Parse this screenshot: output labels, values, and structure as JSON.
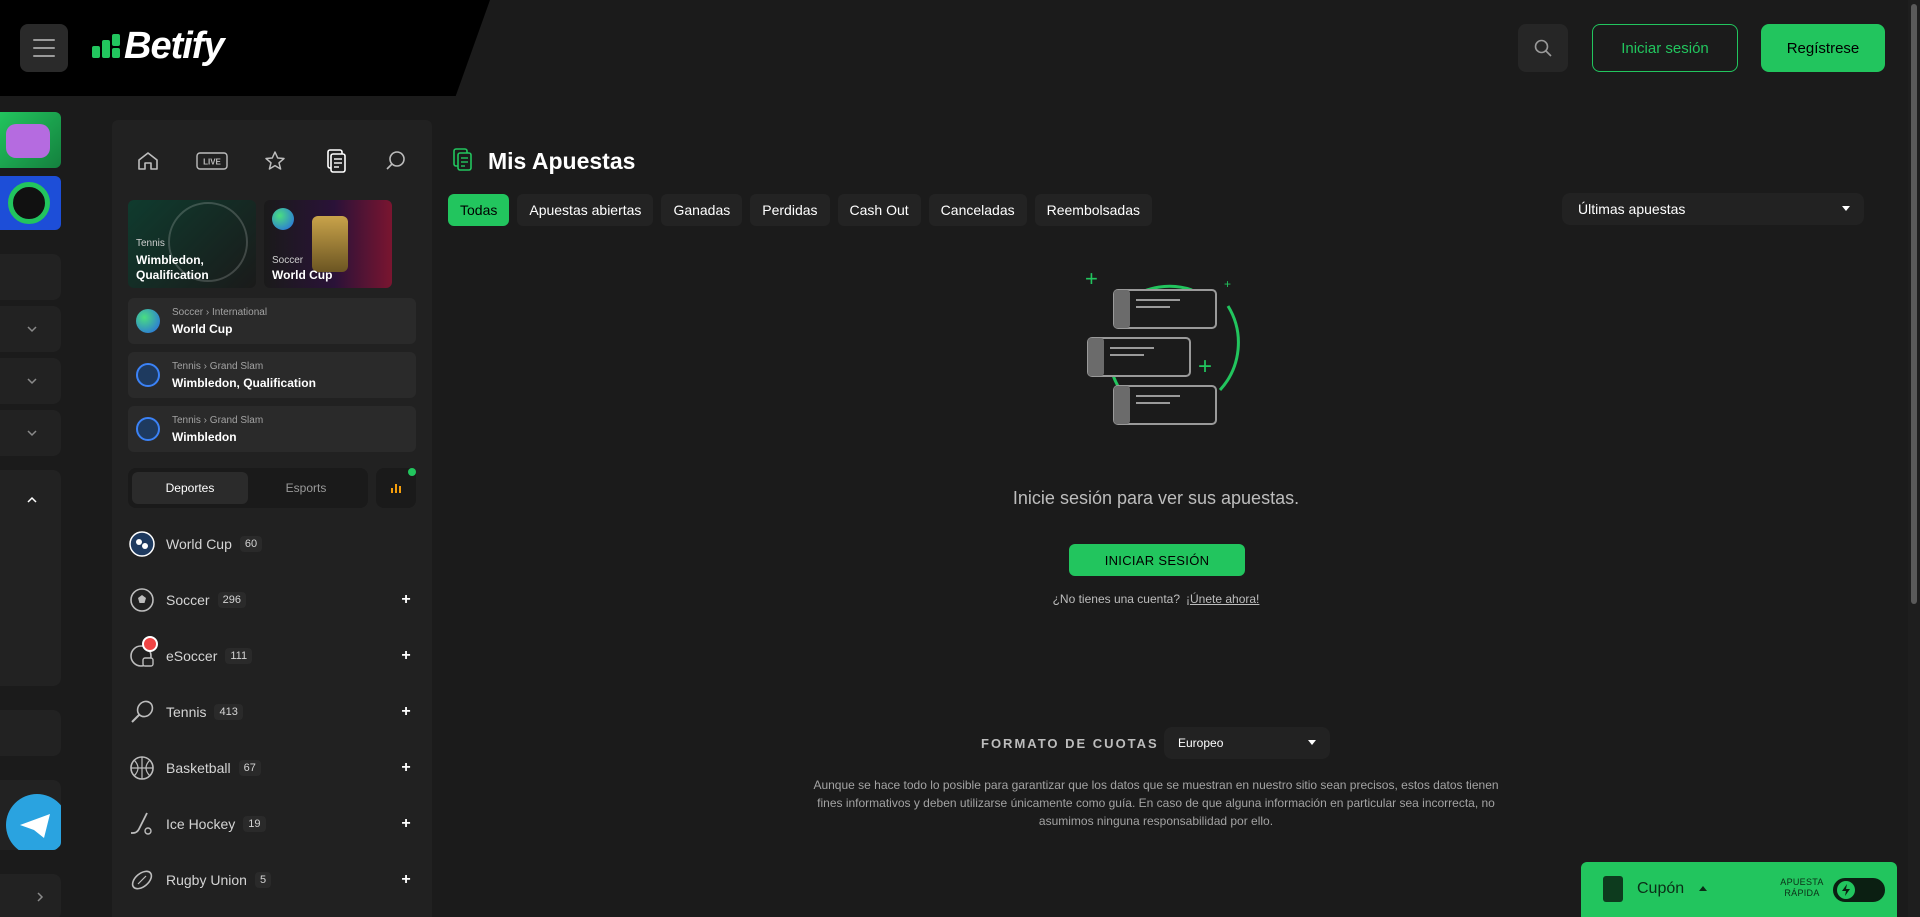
{
  "header": {
    "logo_text": "Betify",
    "login_label": "Iniciar sesión",
    "register_label": "Regístrese"
  },
  "sidebar": {
    "nav_icons": [
      "home-icon",
      "live-icon",
      "star-icon",
      "bets-slip-icon",
      "search-icon"
    ],
    "live_badge": "LIVE",
    "featured": [
      {
        "sport": "Tennis",
        "event": "Wimbledon, Qualification"
      },
      {
        "sport": "Soccer",
        "event": "World Cup"
      }
    ],
    "events": [
      {
        "crumb": "Soccer › International",
        "name": "World Cup"
      },
      {
        "crumb": "Tennis › Grand Slam",
        "name": "Wimbledon, Qualification"
      },
      {
        "crumb": "Tennis › Grand Slam",
        "name": "Wimbledon"
      }
    ],
    "segment": {
      "sports": "Deportes",
      "esports": "Esports"
    },
    "sports": [
      {
        "name": "World Cup",
        "count": "60"
      },
      {
        "name": "Soccer",
        "count": "296"
      },
      {
        "name": "eSoccer",
        "count": "111"
      },
      {
        "name": "Tennis",
        "count": "413"
      },
      {
        "name": "Basketball",
        "count": "67"
      },
      {
        "name": "Ice Hockey",
        "count": "19"
      },
      {
        "name": "Rugby Union",
        "count": "5"
      }
    ]
  },
  "main": {
    "title": "Mis Apuestas",
    "tabs": [
      "Todas",
      "Apuestas abiertas",
      "Ganadas",
      "Perdidas",
      "Cash Out",
      "Canceladas",
      "Reembolsadas"
    ],
    "sort_selected": "Últimas apuestas",
    "empty_message": "Inicie sesión para ver sus apuestas.",
    "cta_label": "INICIAR SESIÓN",
    "no_account": "¿No tienes una cuenta?",
    "join_link": "¡Únete ahora!",
    "odds_label": "FORMATO DE CUOTAS",
    "odds_selected": "Europeo",
    "disclaimer": "Aunque se hace todo lo posible para garantizar que los datos que se muestran en nuestro sitio sean precisos, estos datos tienen fines informativos y deben utilizarse únicamente como guía. En caso de que alguna información en particular sea incorrecta, no asumimos ninguna responsabilidad por ello."
  },
  "coupon": {
    "label": "Cupón",
    "quick_bet": "APUESTA RÁPIDA"
  },
  "colors": {
    "accent": "#22c55e",
    "background": "#1b1b1b",
    "panel": "#212121"
  }
}
